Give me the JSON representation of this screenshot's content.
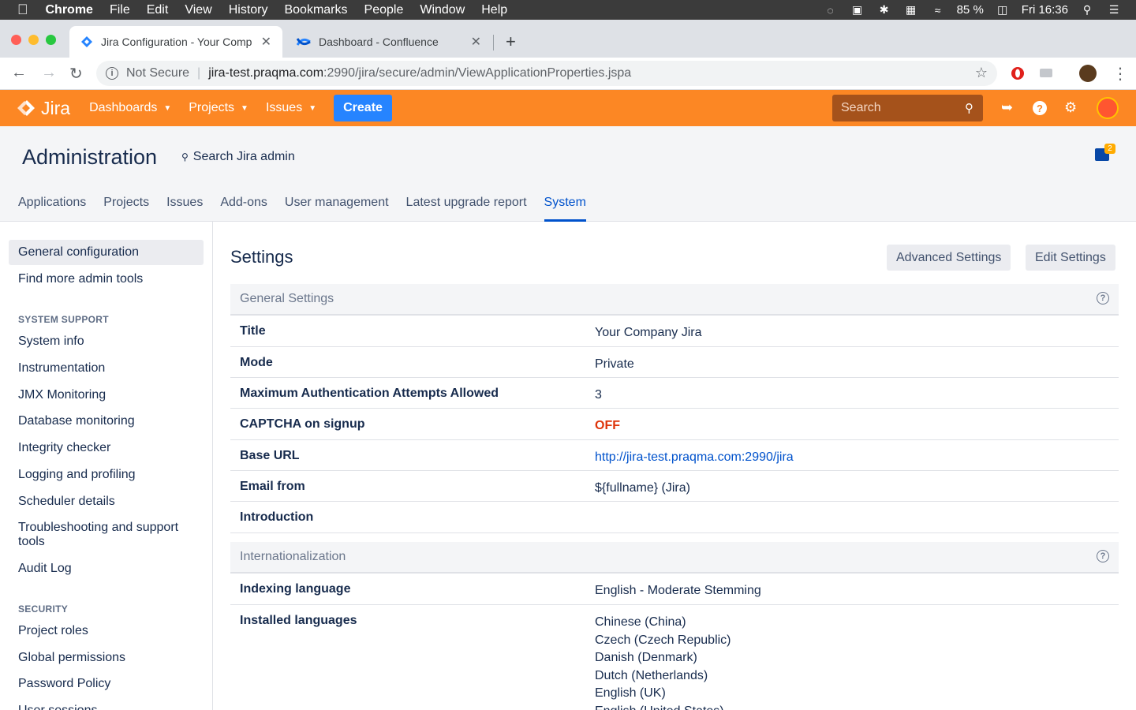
{
  "mac_menu": {
    "app": "Chrome",
    "items": [
      "File",
      "Edit",
      "View",
      "History",
      "Bookmarks",
      "People",
      "Window",
      "Help"
    ],
    "battery": "85 %",
    "clock": "Fri 16:36"
  },
  "browser": {
    "tabs": [
      {
        "title": "Jira Configuration - Your Comp",
        "active": true
      },
      {
        "title": "Dashboard - Confluence",
        "active": false
      }
    ],
    "address": {
      "security": "Not Secure",
      "host": "jira-test.praqma.com",
      "path": ":2990/jira/secure/admin/ViewApplicationProperties.jspa"
    }
  },
  "jira_nav": {
    "logo": "Jira",
    "items": [
      "Dashboards",
      "Projects",
      "Issues"
    ],
    "create": "Create",
    "search_placeholder": "Search"
  },
  "admin": {
    "title": "Administration",
    "search": "Search Jira admin",
    "feedback_count": "2",
    "tabs": [
      "Applications",
      "Projects",
      "Issues",
      "Add-ons",
      "User management",
      "Latest upgrade report",
      "System"
    ],
    "active_tab": "System"
  },
  "sidebar": {
    "top_links": [
      "General configuration",
      "Find more admin tools"
    ],
    "system_support_heading": "SYSTEM SUPPORT",
    "system_support_links": [
      "System info",
      "Instrumentation",
      "JMX Monitoring",
      "Database monitoring",
      "Integrity checker",
      "Logging and profiling",
      "Scheduler details",
      "Troubleshooting and support tools",
      "Audit Log"
    ],
    "security_heading": "SECURITY",
    "security_links": [
      "Project roles",
      "Global permissions",
      "Password Policy",
      "User sessions"
    ]
  },
  "main": {
    "title": "Settings",
    "advanced_button": "Advanced Settings",
    "edit_button": "Edit Settings",
    "general_heading": "General Settings",
    "general_rows": [
      {
        "label": "Title",
        "value": "Your Company Jira"
      },
      {
        "label": "Mode",
        "value": "Private"
      },
      {
        "label": "Maximum Authentication Attempts Allowed",
        "value": "3"
      },
      {
        "label": "CAPTCHA on signup",
        "value": "OFF"
      },
      {
        "label": "Base URL",
        "value": "http://jira-test.praqma.com:2990/jira"
      },
      {
        "label": "Email from",
        "value": "${fullname} (Jira)"
      },
      {
        "label": "Introduction",
        "value": ""
      }
    ],
    "i18n_heading": "Internationalization",
    "indexing_label": "Indexing language",
    "indexing_value": "English - Moderate Stemming",
    "installed_label": "Installed languages",
    "installed_languages": [
      "Chinese (China)",
      "Czech (Czech Republic)",
      "Danish (Denmark)",
      "Dutch (Netherlands)",
      "English (UK)",
      "English (United States)"
    ]
  }
}
